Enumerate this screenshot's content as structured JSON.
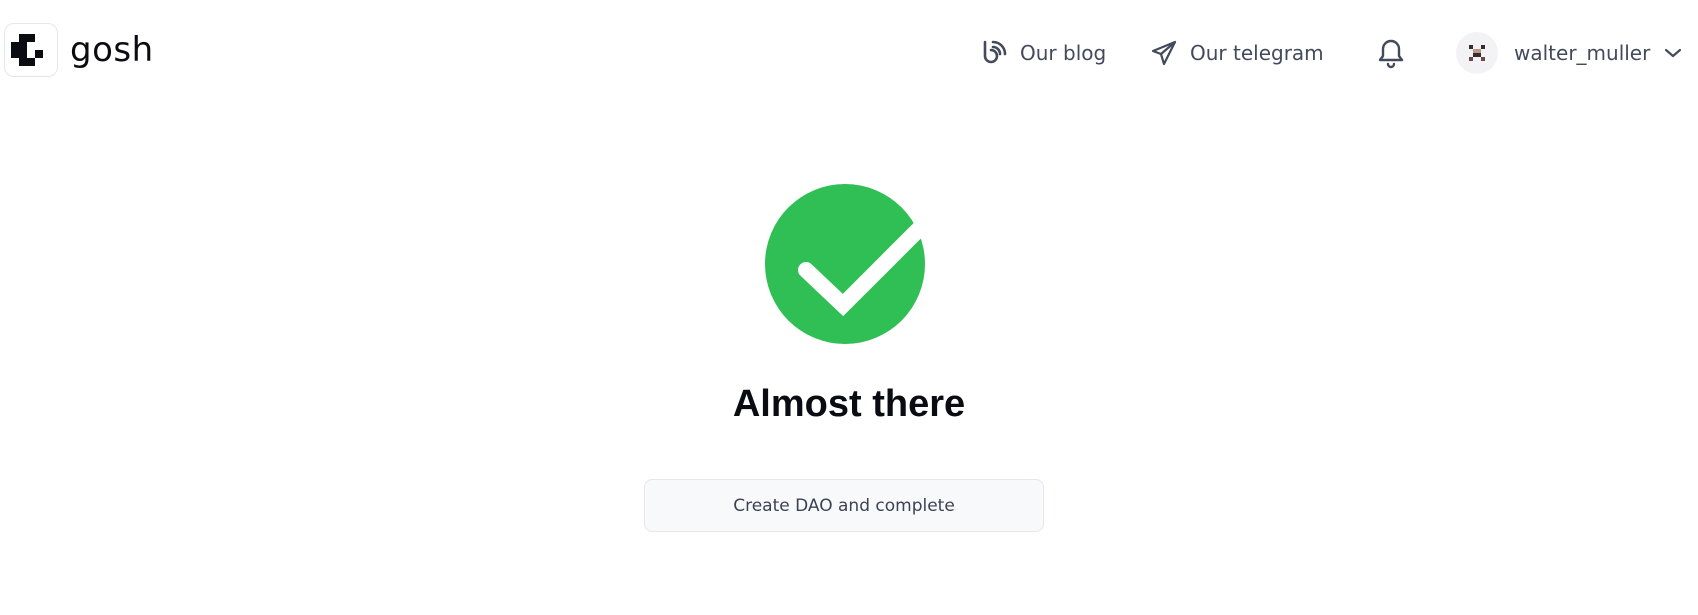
{
  "app": {
    "brand": "gosh",
    "logo_icon": "gosh-logo-icon"
  },
  "header": {
    "nav": [
      {
        "label": "Our blog",
        "icon": "blog-rss-icon"
      },
      {
        "label": "Our telegram",
        "icon": "telegram-paper-plane-icon"
      }
    ],
    "notifications_icon": "bell-icon",
    "user": {
      "username": "walter_muller",
      "avatar_icon": "pixel-avatar-icon",
      "menu_icon": "chevron-down-icon"
    }
  },
  "main": {
    "status_icon": "check-circle-icon",
    "title": "Almost there",
    "cta_label": "Create DAO and complete"
  },
  "colors": {
    "success": "#2fbf55",
    "text_primary": "#0b0b12",
    "text_secondary": "#434a5c",
    "button_bg": "#f8f9fb",
    "border": "#e6e7ec"
  }
}
